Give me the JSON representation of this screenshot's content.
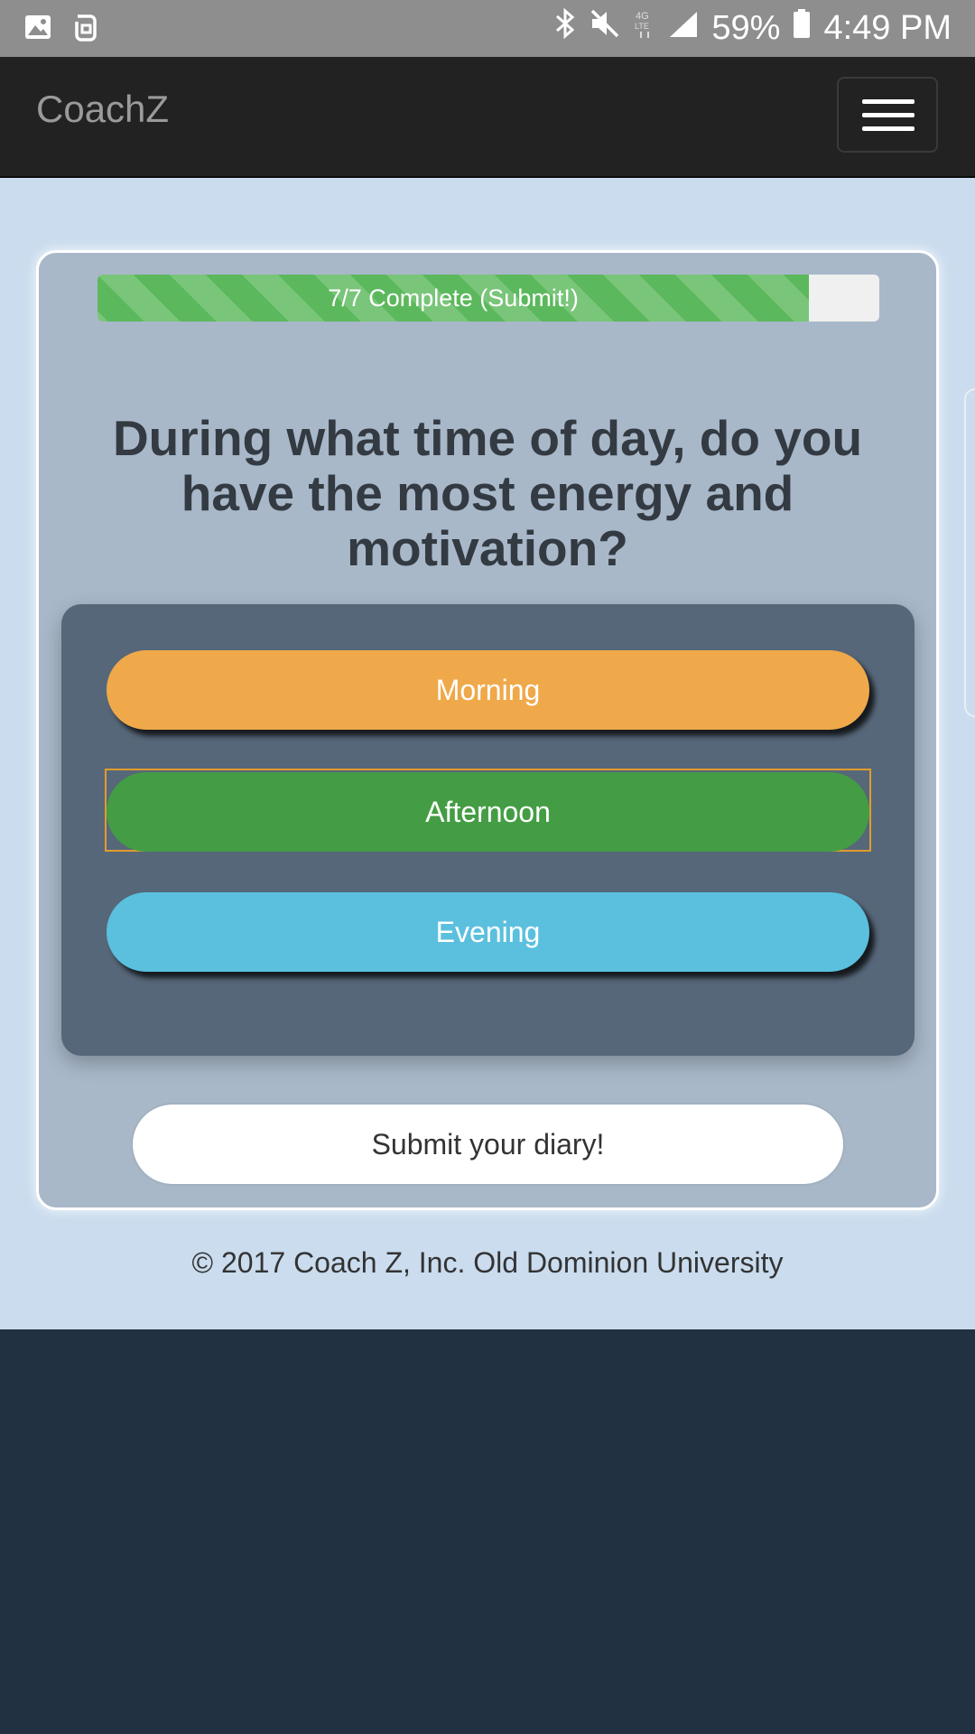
{
  "status_bar": {
    "icons_left": [
      "gallery-icon",
      "notification-app-icon"
    ],
    "icons_right": [
      "bluetooth-icon",
      "mute-icon",
      "lte-icon",
      "signal-icon",
      "battery-icon"
    ],
    "battery": "59%",
    "time": "4:49 PM"
  },
  "navbar": {
    "brand": "CoachZ",
    "menu_icon": "hamburger-icon"
  },
  "progress": {
    "label": "7/7 Complete (Submit!)",
    "percent": 91,
    "color": "#5cb85c"
  },
  "question": {
    "text": "During what time of day, do you have the most energy and motivation?"
  },
  "options": [
    {
      "label": "Morning",
      "color": "#efa94a"
    },
    {
      "label": "Afternoon",
      "color": "#449d44",
      "focused": true
    },
    {
      "label": "Evening",
      "color": "#5bc0de"
    }
  ],
  "submit": {
    "label": "Submit your diary!"
  },
  "footer": {
    "text": "© 2017 Coach Z, Inc. Old Dominion University"
  }
}
